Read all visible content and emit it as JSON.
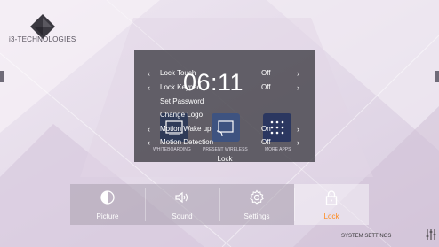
{
  "brand": {
    "text": "i3-TECHNOLOGIES"
  },
  "clock": {
    "time": "06:11"
  },
  "apps": [
    {
      "label": "WHITEBOARDING",
      "icon": "whiteboard-icon",
      "color": "#2f3b58"
    },
    {
      "label": "PRESENT WIRELESS",
      "icon": "cast-icon",
      "color": "#3e5380"
    },
    {
      "label": "MORE APPS",
      "icon": "grid-icon",
      "color": "#2b3760"
    }
  ],
  "lock_menu": {
    "title": "Lock",
    "items": [
      {
        "label": "Lock Touch",
        "value": "Off",
        "has_arrows": true
      },
      {
        "label": "Lock Keypad",
        "value": "Off",
        "has_arrows": true
      },
      {
        "label": "Set Password",
        "value": "",
        "has_arrows": false
      },
      {
        "label": "Change Logo",
        "value": "",
        "has_arrows": false
      },
      {
        "label": "Motion Wake up",
        "value": "On",
        "has_arrows": true
      },
      {
        "label": "Motion Detection",
        "value": "Off",
        "has_arrows": true
      }
    ]
  },
  "tabs": [
    {
      "label": "Picture",
      "icon": "picture-icon"
    },
    {
      "label": "Sound",
      "icon": "speaker-icon"
    },
    {
      "label": "Settings",
      "icon": "gear-icon"
    },
    {
      "label": "Lock",
      "icon": "padlock-icon",
      "active": true
    }
  ],
  "footer": {
    "system_settings": "SYSTEM SETTINGS"
  },
  "colors": {
    "accent": "#ff8a1c",
    "panel": "#403e46"
  }
}
